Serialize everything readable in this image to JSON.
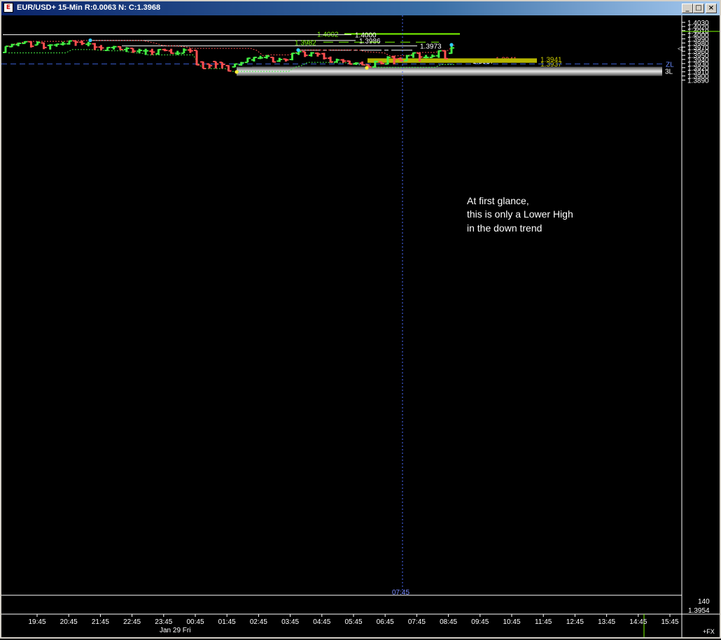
{
  "window": {
    "title": "EUR/USD+ 15-Min R:0.0063 N: C:1.3968",
    "icon": "chart-app-icon",
    "buttons": {
      "minimize": "minimize-icon",
      "maximize": "maximize-icon",
      "close": "close-icon"
    }
  },
  "colors": {
    "background": "#000000",
    "up_bar": "#44ee44",
    "down_bar": "#ff5050",
    "envelope_upper": "#ff5050",
    "envelope_lower": "#44ee44",
    "level_white": "#ffffff",
    "level_green": "#7cfc00",
    "zone_fill": "#b5b500",
    "zl_line": "#3a5fd0",
    "support_bar": "#9a9a9a",
    "marker_cyan": "#33ccff",
    "marker_yellow": "#ffee33"
  },
  "chart_data": {
    "type": "ohlc",
    "title": "",
    "ylim": [
      1.3885,
      1.4036
    ],
    "y_ticks": [
      "1.4030",
      "1.4020",
      "1.4010",
      "1.4000",
      "1.3990",
      "1.3980",
      "1.3970",
      "1.3960",
      "1.3950",
      "1.3940",
      "1.3930",
      "1.3920",
      "1.3910",
      "1.3900",
      "1.3890"
    ],
    "x_ticks": [
      "19:45",
      "20:45",
      "21:45",
      "22:45",
      "23:45",
      "00:45",
      "01:45",
      "02:45",
      "03:45",
      "04:45",
      "05:45",
      "06:45",
      "07:45",
      "08:45",
      "09:45",
      "10:45",
      "11:45",
      "12:45",
      "13:45",
      "14:45",
      "15:45"
    ],
    "date_label": "Jan 29 Fri",
    "cursor_time_label": "07:45",
    "ohlc": [
      [
        1.3957,
        1.3972,
        1.3956,
        1.3972
      ],
      [
        1.3971,
        1.3978,
        1.397,
        1.3976
      ],
      [
        1.3976,
        1.3981,
        1.3972,
        1.3979
      ],
      [
        1.3979,
        1.3984,
        1.3978,
        1.3983
      ],
      [
        1.3983,
        1.3984,
        1.3969,
        1.3972
      ],
      [
        1.3975,
        1.3984,
        1.3975,
        1.3981
      ],
      [
        1.398,
        1.3981,
        1.3965,
        1.3969
      ],
      [
        1.3974,
        1.3977,
        1.3964,
        1.3975
      ],
      [
        1.3975,
        1.3978,
        1.3971,
        1.3977
      ],
      [
        1.3977,
        1.3983,
        1.3974,
        1.3978
      ],
      [
        1.3978,
        1.3986,
        1.3976,
        1.3985
      ],
      [
        1.3985,
        1.3986,
        1.3973,
        1.3982
      ],
      [
        1.3982,
        1.3986,
        1.3975,
        1.3979
      ],
      [
        1.3977,
        1.3983,
        1.3972,
        1.3978
      ],
      [
        1.3978,
        1.398,
        1.3963,
        1.397
      ],
      [
        1.397,
        1.3975,
        1.3962,
        1.3968
      ],
      [
        1.3962,
        1.397,
        1.3961,
        1.3969
      ],
      [
        1.3969,
        1.3973,
        1.3964,
        1.3971
      ],
      [
        1.3971,
        1.3972,
        1.3963,
        1.3964
      ],
      [
        1.3964,
        1.397,
        1.3958,
        1.3967
      ],
      [
        1.3967,
        1.3967,
        1.3956,
        1.396
      ],
      [
        1.396,
        1.3966,
        1.3955,
        1.3962
      ],
      [
        1.3961,
        1.3966,
        1.3951,
        1.3961
      ],
      [
        1.396,
        1.3966,
        1.3951,
        1.3958
      ],
      [
        1.3954,
        1.3965,
        1.3952,
        1.3964
      ],
      [
        1.3964,
        1.3966,
        1.396,
        1.3962
      ],
      [
        1.3961,
        1.3966,
        1.3954,
        1.3955
      ],
      [
        1.3955,
        1.3961,
        1.3951,
        1.3955
      ],
      [
        1.3955,
        1.3967,
        1.3955,
        1.3963
      ],
      [
        1.3963,
        1.3967,
        1.3956,
        1.3961
      ],
      [
        1.3962,
        1.3962,
        1.3926,
        1.3927
      ],
      [
        1.3934,
        1.3935,
        1.3918,
        1.3918
      ],
      [
        1.3929,
        1.3929,
        1.3918,
        1.3925
      ],
      [
        1.3935,
        1.3935,
        1.3918,
        1.3929
      ],
      [
        1.3933,
        1.3933,
        1.3918,
        1.3928
      ],
      [
        1.3925,
        1.3926,
        1.3911,
        1.3912
      ],
      [
        1.3922,
        1.393,
        1.3921,
        1.3929
      ],
      [
        1.3927,
        1.3934,
        1.3925,
        1.3932
      ],
      [
        1.3933,
        1.3944,
        1.3933,
        1.3943
      ],
      [
        1.3939,
        1.3946,
        1.3935,
        1.3945
      ],
      [
        1.3943,
        1.3949,
        1.3941,
        1.3944
      ],
      [
        1.3945,
        1.3951,
        1.3942,
        1.3948
      ],
      [
        1.3945,
        1.3946,
        1.3933,
        1.3934
      ],
      [
        1.3936,
        1.3944,
        1.3934,
        1.394
      ],
      [
        1.3941,
        1.3942,
        1.3935,
        1.3939
      ],
      [
        1.394,
        1.3956,
        1.3938,
        1.3955
      ],
      [
        1.3955,
        1.3963,
        1.3951,
        1.3959
      ],
      [
        1.3959,
        1.3959,
        1.3946,
        1.395
      ],
      [
        1.395,
        1.3958,
        1.3947,
        1.3956
      ],
      [
        1.3955,
        1.3957,
        1.3947,
        1.3953
      ],
      [
        1.3954,
        1.3956,
        1.394,
        1.3943
      ],
      [
        1.3943,
        1.3947,
        1.3932,
        1.3934
      ],
      [
        1.3934,
        1.3942,
        1.3933,
        1.3939
      ],
      [
        1.3939,
        1.3941,
        1.3932,
        1.3936
      ],
      [
        1.3936,
        1.3937,
        1.3928,
        1.3929
      ],
      [
        1.393,
        1.3933,
        1.3927,
        1.3931
      ],
      [
        1.3931,
        1.3935,
        1.3926,
        1.3927
      ],
      [
        1.3927,
        1.3927,
        1.3921,
        1.3922
      ],
      [
        1.3922,
        1.3937,
        1.3921,
        1.3935
      ],
      [
        1.3934,
        1.3935,
        1.3928,
        1.393
      ],
      [
        1.3929,
        1.3948,
        1.3928,
        1.3945
      ],
      [
        1.3946,
        1.3949,
        1.3928,
        1.3941
      ],
      [
        1.3942,
        1.3945,
        1.3935,
        1.3937
      ],
      [
        1.3937,
        1.3951,
        1.3937,
        1.3949
      ],
      [
        1.395,
        1.3957,
        1.3944,
        1.3956
      ],
      [
        1.3955,
        1.3957,
        1.3935,
        1.3946
      ],
      [
        1.3945,
        1.3951,
        1.3943,
        1.3945
      ],
      [
        1.3945,
        1.3952,
        1.3945,
        1.3948
      ],
      [
        1.3949,
        1.3962,
        1.3944,
        1.3961
      ],
      [
        1.3961,
        1.3962,
        1.3941,
        1.3942
      ],
      [
        1.3955,
        1.3975,
        1.3954,
        1.3968
      ]
    ],
    "levels": [
      {
        "label": "1.4002",
        "value": 1.4002,
        "style": "solid-green"
      },
      {
        "label": "1.4000",
        "value": 1.4,
        "style": "solid-white"
      },
      {
        "label": "1.3986",
        "value": 1.3986,
        "style": "solid-white"
      },
      {
        "label": "1.3982",
        "value": 1.3982,
        "style": "dashed-green"
      },
      {
        "label": "1.3973",
        "value": 1.3973,
        "style": "solid-white"
      },
      {
        "label": "1.3941",
        "value": 1.3941,
        "style": "solid-red"
      },
      {
        "label": "1.3937",
        "value": 1.3937,
        "style": "solid-white"
      }
    ],
    "zone": {
      "top": 1.3941,
      "bottom": 1.3937,
      "label_top": "1.3941",
      "label_bottom": "1.3937"
    },
    "zl": {
      "value": 1.3936,
      "label": "ZL"
    },
    "support_3l": {
      "value": 1.3912,
      "label": "3L"
    },
    "price_marker_value": 1.3969,
    "annotation": [
      "At first glance,",
      "this is only a Lower High",
      "in the down trend"
    ],
    "bottom_panel": {
      "value": "140",
      "price": "1.3954",
      "corner": "+FX"
    }
  }
}
